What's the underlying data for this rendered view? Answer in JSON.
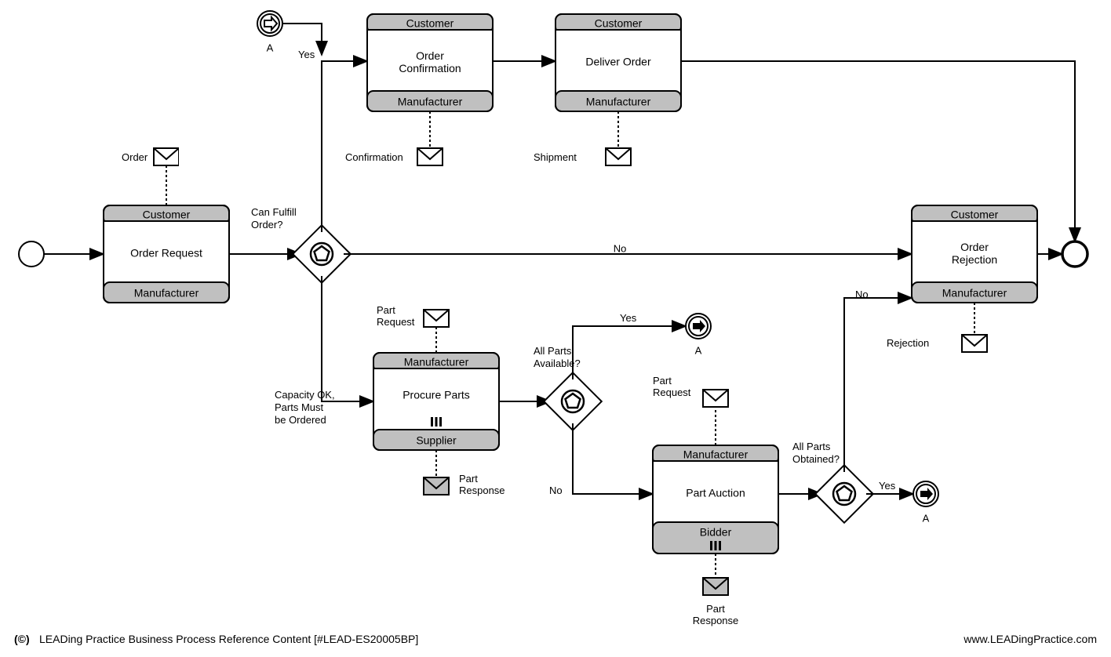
{
  "footer": {
    "left_logo": "(©)",
    "left_text": "LEADing Practice Business Process Reference Content [#LEAD-ES20005BP]",
    "right_text": "www.LEADingPractice.com"
  },
  "link_A": "A",
  "activities": {
    "order_request": {
      "top": "Customer",
      "center": "Order Request",
      "bottom": "Manufacturer"
    },
    "order_confirmation": {
      "top": "Customer",
      "center": "Order\nConfirmation",
      "bottom": "Manufacturer"
    },
    "deliver_order": {
      "top": "Customer",
      "center": "Deliver Order",
      "bottom": "Manufacturer"
    },
    "order_rejection": {
      "top": "Customer",
      "center": "Order\nRejection",
      "bottom": "Manufacturer"
    },
    "procure_parts": {
      "top": "Manufacturer",
      "center": "Procure Parts",
      "bottom": "Supplier"
    },
    "part_auction": {
      "top": "Manufacturer",
      "center": "Part Auction",
      "bottom": "Bidder"
    }
  },
  "messages": {
    "order": "Order",
    "confirmation": "Confirmation",
    "shipment": "Shipment",
    "rejection": "Rejection",
    "part_request_1": "Part\nRequest",
    "part_response_1": "Part\nResponse",
    "part_request_2": "Part\nRequest",
    "part_response_2": "Part\nResponse"
  },
  "gateways": {
    "can_fulfill": "Can Fulfill\nOrder?",
    "all_parts_available": "All Parts\nAvailable?",
    "all_parts_obtained": "All Parts\nObtained?"
  },
  "branches": {
    "yes1": "Yes",
    "no1": "No",
    "capacity_ok": "Capacity OK,\nParts Must\nbe Ordered",
    "yes2": "Yes",
    "no2": "No",
    "yes3": "Yes",
    "no3": "No"
  }
}
